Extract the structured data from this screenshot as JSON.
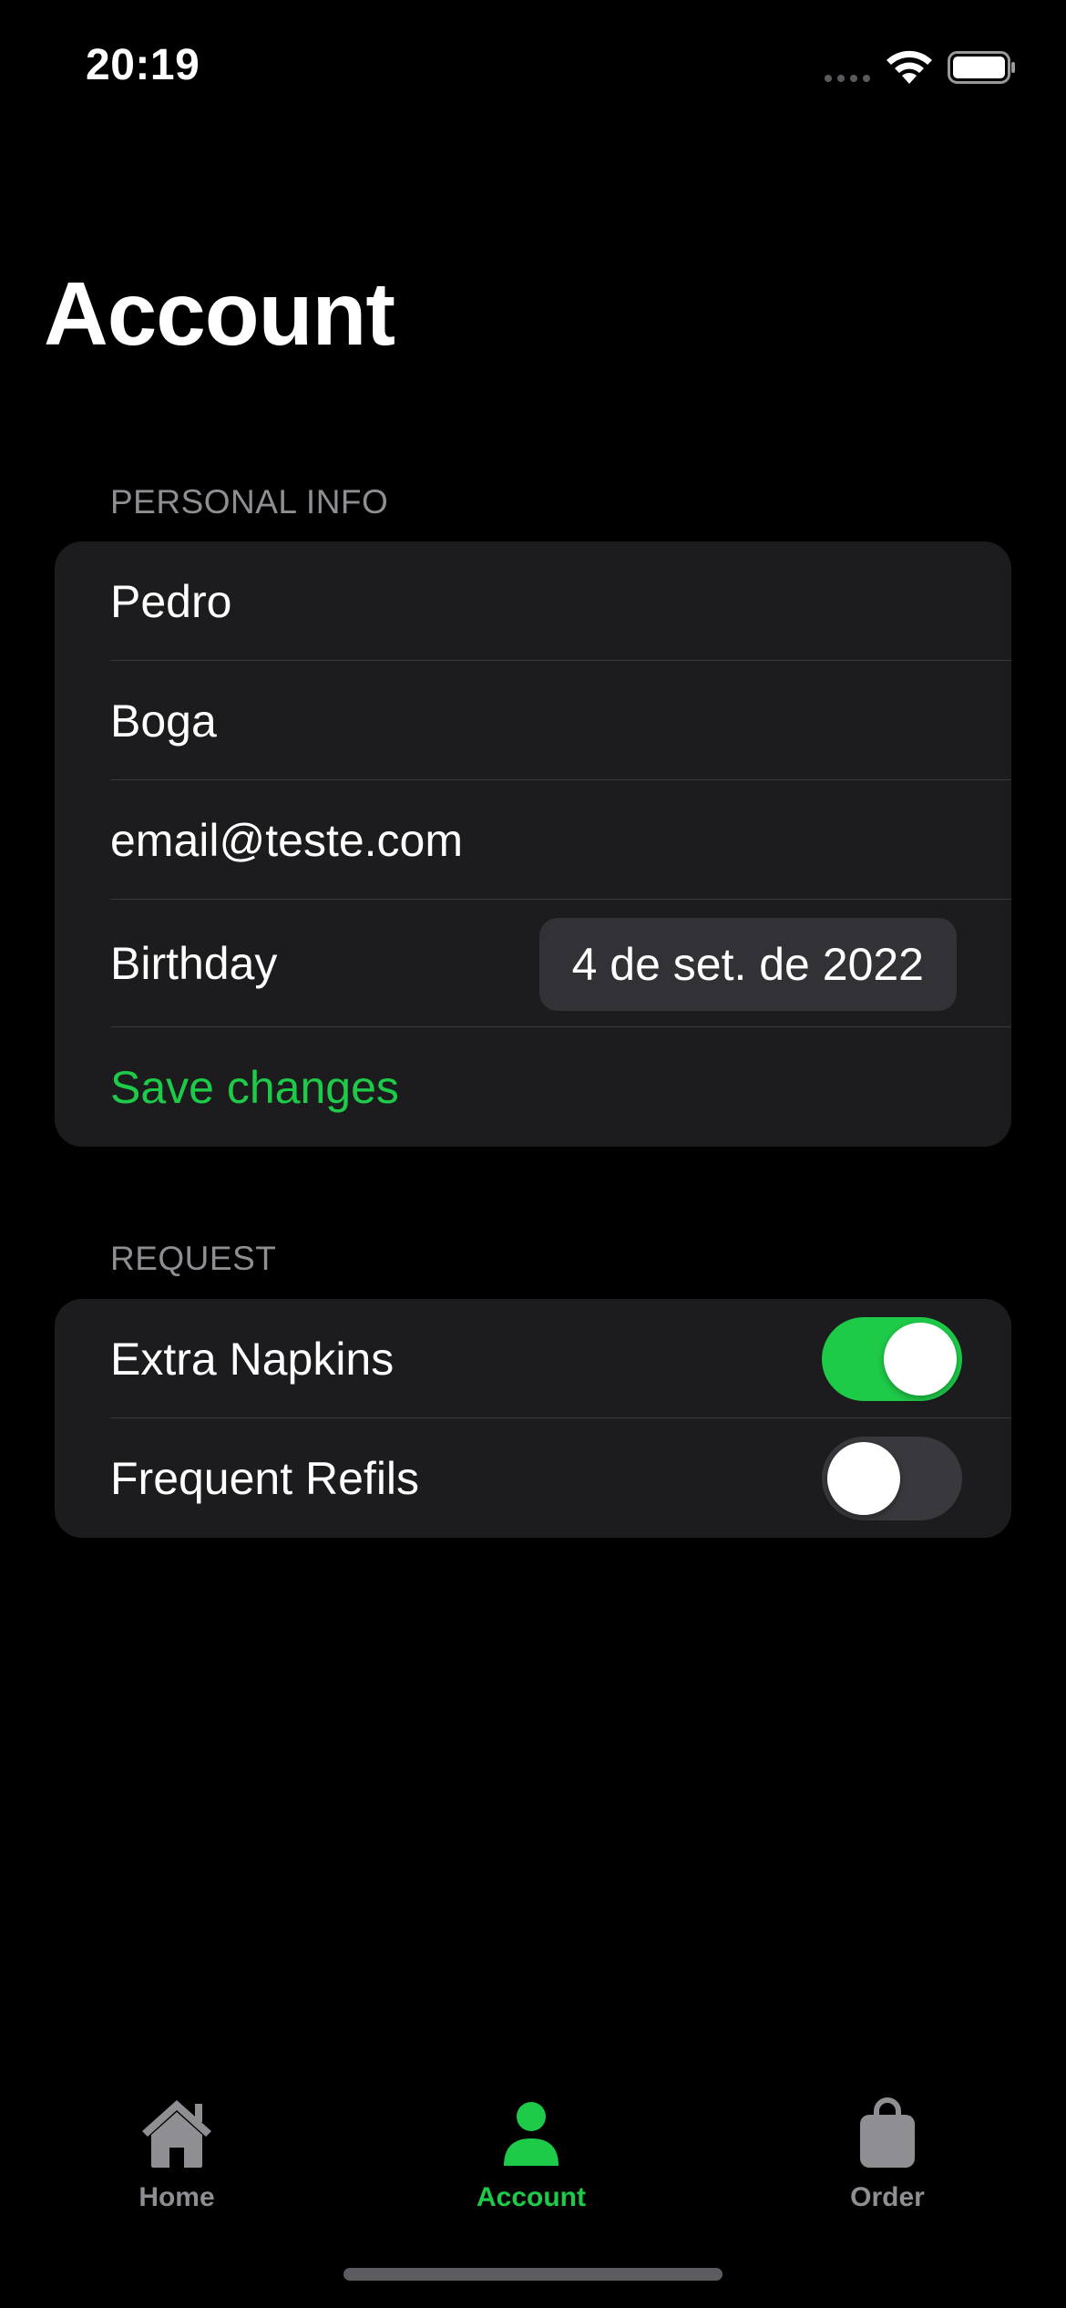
{
  "status_bar": {
    "time": "20:19",
    "icons": [
      "cellular-dots-icon",
      "wifi-icon",
      "battery-icon"
    ]
  },
  "header": {
    "title": "Account"
  },
  "personal_info": {
    "section_label": "PERSONAL INFO",
    "first_name": "Pedro",
    "last_name": "Boga",
    "email": "email@teste.com",
    "birthday_label": "Birthday",
    "birthday_value": "4 de set. de 2022",
    "save_label": "Save changes"
  },
  "request": {
    "section_label": "REQUEST",
    "toggles": [
      {
        "label": "Extra Napkins",
        "on": true
      },
      {
        "label": "Frequent Refils",
        "on": false
      }
    ]
  },
  "tab_bar": {
    "tabs": [
      {
        "label": "Home",
        "icon": "house-icon",
        "active": false
      },
      {
        "label": "Account",
        "icon": "person-icon",
        "active": true
      },
      {
        "label": "Order",
        "icon": "bag-icon",
        "active": false
      }
    ]
  },
  "colors": {
    "accent": "#1ecb48",
    "background": "#000000",
    "group_background": "#1c1c1e",
    "secondary_text": "#8e8e93"
  }
}
